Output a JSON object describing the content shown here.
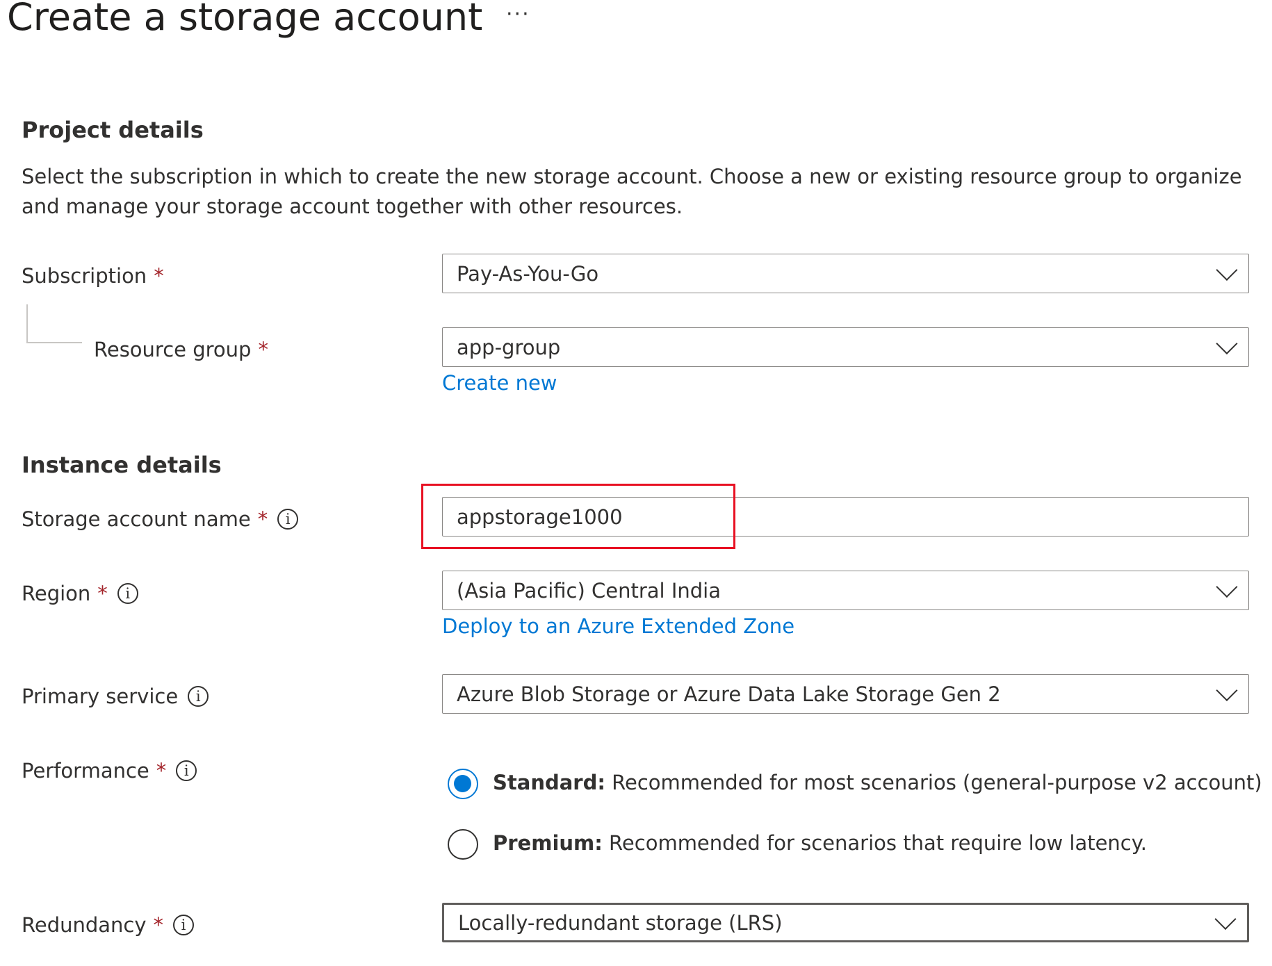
{
  "page": {
    "title": "Create a storage account",
    "more_label": "···"
  },
  "project": {
    "heading": "Project details",
    "description": "Select the subscription in which to create the new storage account. Choose a new or existing resource group to organize and manage your storage account together with other resources.",
    "subscription": {
      "label": "Subscription",
      "required": "*",
      "value": "Pay-As-You-Go"
    },
    "resource_group": {
      "label": "Resource group",
      "required": "*",
      "value": "app-group",
      "create_new": "Create new"
    }
  },
  "instance": {
    "heading": "Instance details",
    "storage_name": {
      "label": "Storage account name",
      "required": "*",
      "info": "i",
      "value": "appstorage1000"
    },
    "region": {
      "label": "Region",
      "required": "*",
      "info": "i",
      "value": "(Asia Pacific) Central India",
      "link": "Deploy to an Azure Extended Zone"
    },
    "primary_service": {
      "label": "Primary service",
      "info": "i",
      "value": "Azure Blob Storage or Azure Data Lake Storage Gen 2"
    },
    "performance": {
      "label": "Performance",
      "required": "*",
      "info": "i",
      "options": [
        {
          "name": "Standard:",
          "desc": " Recommended for most scenarios (general-purpose v2 account)",
          "checked": true
        },
        {
          "name": "Premium:",
          "desc": " Recommended for scenarios that require low latency.",
          "checked": false
        }
      ]
    },
    "redundancy": {
      "label": "Redundancy",
      "required": "*",
      "info": "i",
      "value": "Locally-redundant storage (LRS)"
    }
  },
  "colors": {
    "accent": "#0078d4",
    "required": "#a4262c",
    "highlight": "#e81123"
  }
}
